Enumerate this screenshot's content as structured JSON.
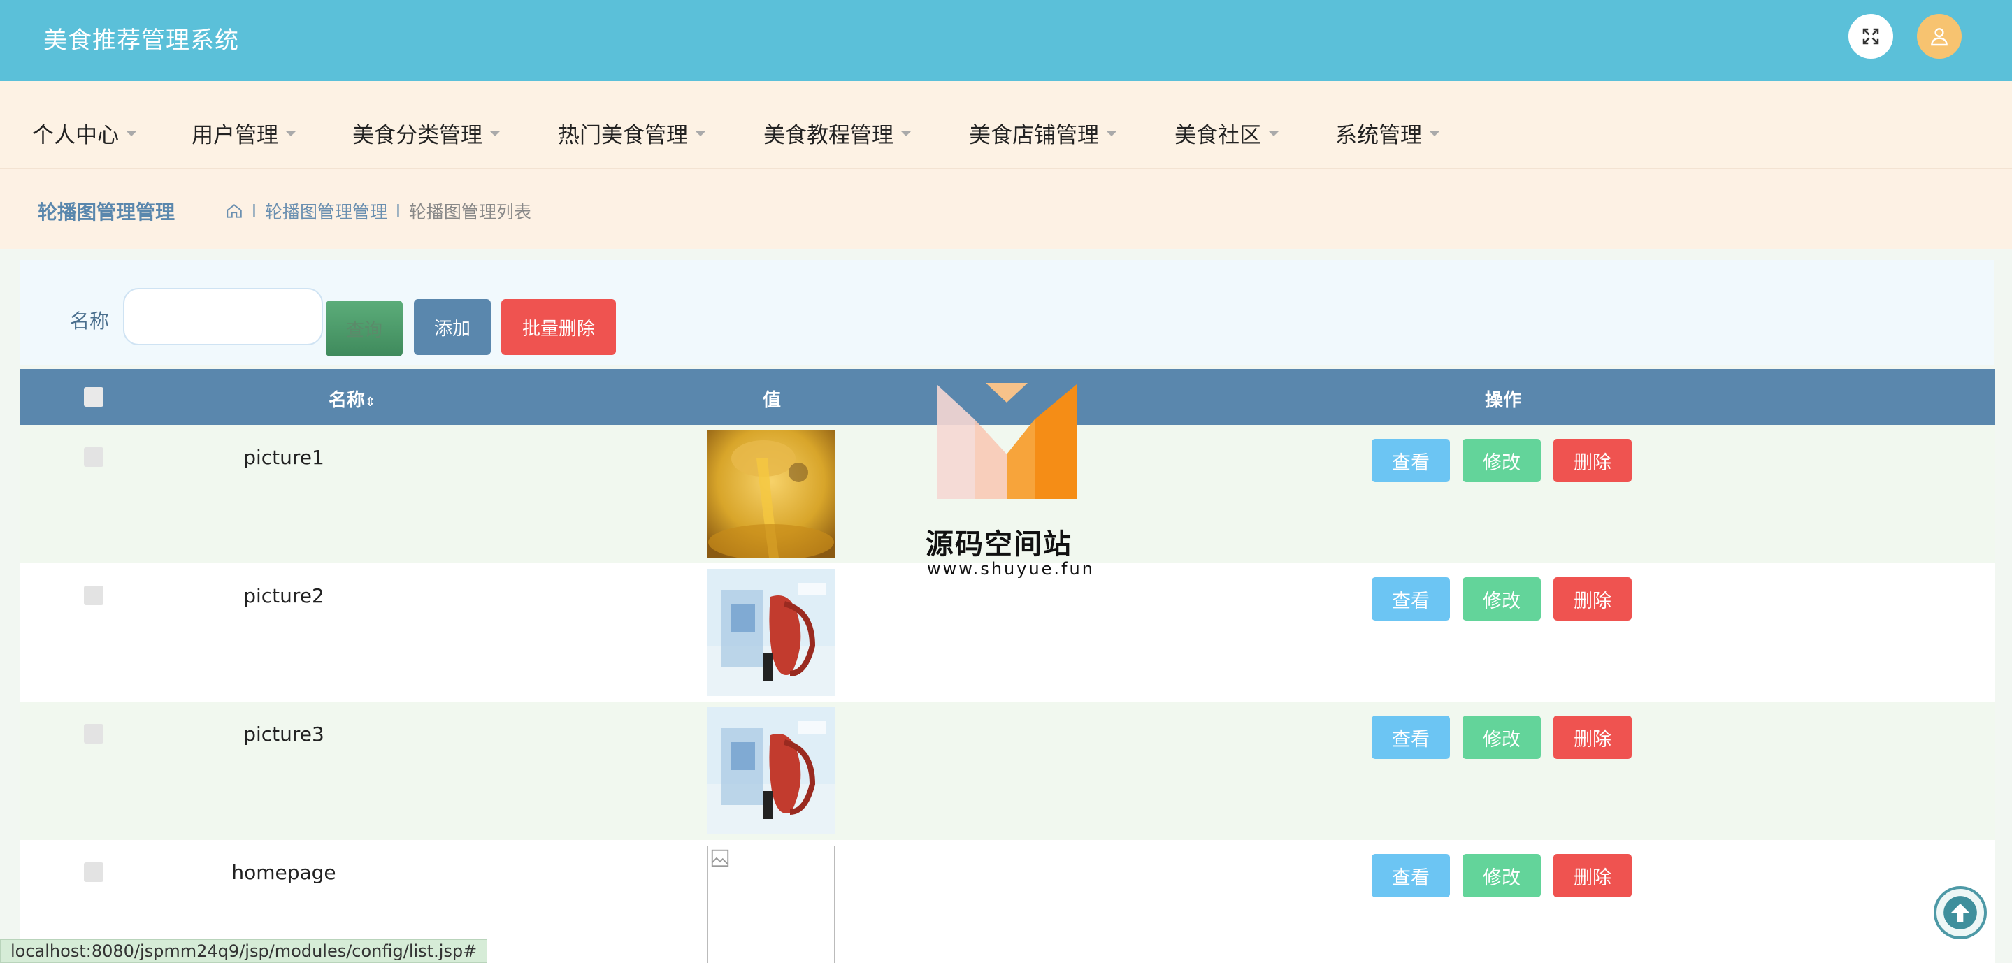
{
  "header": {
    "title": "美食推荐管理系统",
    "fullscreen_icon": "expand-icon",
    "user_icon": "user-icon"
  },
  "nav": {
    "items": [
      {
        "label": "个人中心"
      },
      {
        "label": "用户管理"
      },
      {
        "label": "美食分类管理"
      },
      {
        "label": "热门美食管理"
      },
      {
        "label": "美食教程管理"
      },
      {
        "label": "美食店铺管理"
      },
      {
        "label": "美食社区"
      },
      {
        "label": "系统管理"
      }
    ]
  },
  "breadcrumb": {
    "title": "轮播图管理管理",
    "items": [
      "轮播图管理管理",
      "轮播图管理列表"
    ],
    "sep": "l"
  },
  "search": {
    "label": "名称",
    "value": "",
    "query_label": "查询",
    "add_label": "添加",
    "bulk_delete_label": "批量删除"
  },
  "table": {
    "columns": {
      "name": "名称",
      "value": "值",
      "actions": "操作"
    },
    "rows": [
      {
        "name": "picture1",
        "image": "food-oil-pour"
      },
      {
        "name": "picture2",
        "image": "seafood-poster"
      },
      {
        "name": "picture3",
        "image": "seafood-poster"
      },
      {
        "name": "homepage",
        "image": "broken-image"
      }
    ],
    "actions": {
      "view": "查看",
      "edit": "修改",
      "delete": "删除"
    }
  },
  "watermark": {
    "title": "源码空间站",
    "url": "www.shuyue.fun"
  },
  "status_url": "localhost:8080/jspmm24q9/jsp/modules/config/list.jsp#",
  "colors": {
    "header": "#5bc0d9",
    "table_header": "#5a87ad",
    "view": "#6cc5f3",
    "edit": "#63d49a",
    "delete": "#ef5350"
  }
}
